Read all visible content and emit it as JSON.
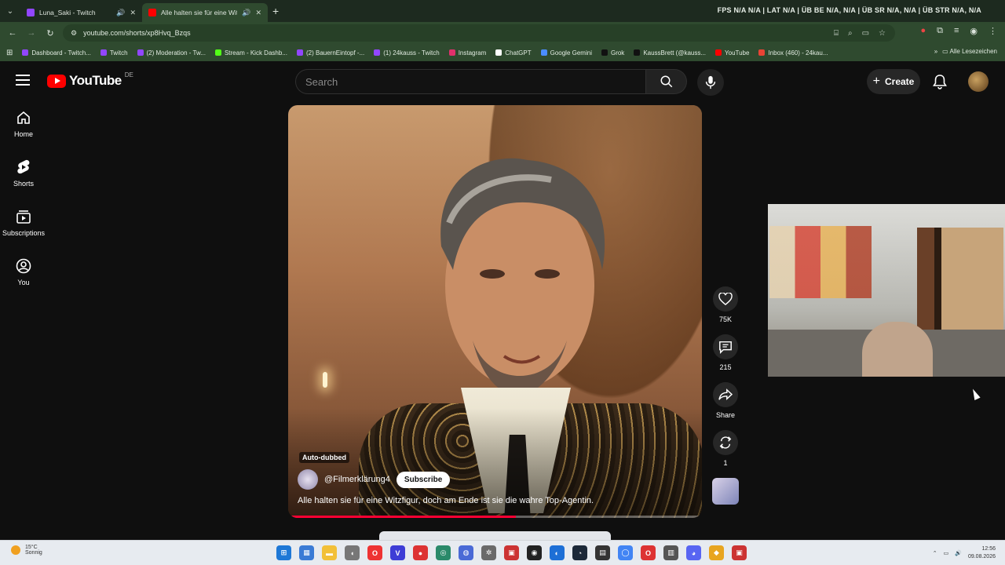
{
  "browser": {
    "tabs": [
      {
        "title": "Luna_Saki - Twitch",
        "color": "#9146ff"
      },
      {
        "title": "Alle halten sie für eine Witz",
        "color": "#ff0000"
      }
    ],
    "stats_text": "FPS N/A N/A | LAT N/A | ÜB BE N/A, N/A | ÜB SR N/A, N/A | ÜB STR N/A, N/A",
    "url": "youtube.com/shorts/xp8Hvq_Bzqs",
    "bookmarks": [
      {
        "label": "Dashboard - Twitch...",
        "color": "#9146ff"
      },
      {
        "label": "Twitch",
        "color": "#9146ff"
      },
      {
        "label": "(2) Moderation - Tw...",
        "color": "#9146ff"
      },
      {
        "label": "Stream - Kick Dashb...",
        "color": "#53fc18"
      },
      {
        "label": "(2) BauernEintopf -...",
        "color": "#9146ff"
      },
      {
        "label": "(1) 24kauss - Twitch",
        "color": "#9146ff"
      },
      {
        "label": "Instagram",
        "color": "#e1306c"
      },
      {
        "label": "ChatGPT",
        "color": "#ffffff"
      },
      {
        "label": "Google Gemini",
        "color": "#4a8cff"
      },
      {
        "label": "Grok",
        "color": "#111111"
      },
      {
        "label": "KaussBrett (@kauss...",
        "color": "#111111"
      },
      {
        "label": "YouTube",
        "color": "#ff0000"
      },
      {
        "label": "Inbox (460) - 24kau...",
        "color": "#ea4335"
      }
    ],
    "all_bookmarks": "Alle Lesezeichen"
  },
  "yt": {
    "logo": "YouTube",
    "country": "DE",
    "search_placeholder": "Search",
    "create": "Create",
    "sidebar": [
      {
        "label": "Home",
        "icon": "home-icon"
      },
      {
        "label": "Shorts",
        "icon": "shorts-icon"
      },
      {
        "label": "Subscriptions",
        "icon": "subscriptions-icon"
      },
      {
        "label": "You",
        "icon": "you-icon"
      }
    ],
    "video": {
      "badge": "Auto-dubbed",
      "channel": "@Filmerklärung4",
      "subscribe": "Subscribe",
      "title": "Alle halten sie für eine Witzfigur, doch am Ende ist sie die wahre Top-Agentin.",
      "progress": 0.55
    },
    "actions": {
      "likes": "75K",
      "comments": "215",
      "share": "Share",
      "remix": "1"
    }
  },
  "taskbar": {
    "temp": "15°C",
    "weather": "Sonnig",
    "time": "12:56",
    "date": "09.08.2026",
    "notification_count": "1"
  }
}
